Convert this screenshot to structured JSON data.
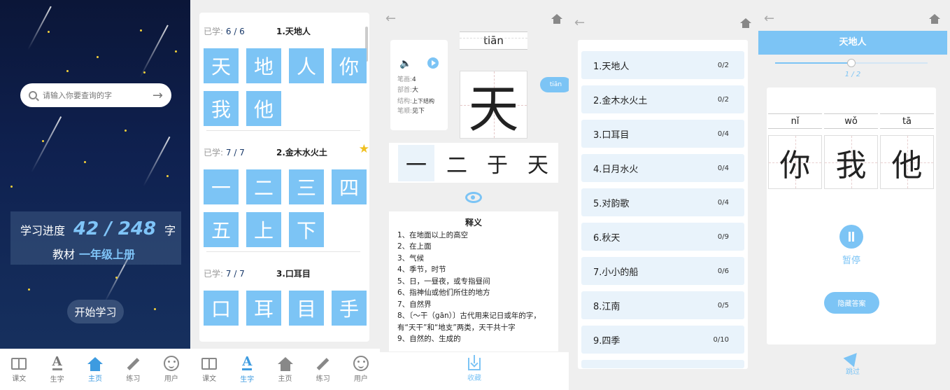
{
  "home": {
    "search_placeholder": "请输入你要查询的字",
    "progress_label": "学习进度",
    "progress_value": "42 / 248",
    "progress_unit": "字",
    "textbook_label": "教材",
    "textbook_value": "一年级上册",
    "start_button": "开始学习"
  },
  "tabs": [
    "课文",
    "生字",
    "主页",
    "练习",
    "用户"
  ],
  "char_list": {
    "lessons": [
      {
        "learned_label": "已学:",
        "learned": "6 / 6",
        "title": "1.天地人",
        "starred": false,
        "chars": [
          "天",
          "地",
          "人",
          "你",
          "我",
          "他"
        ]
      },
      {
        "learned_label": "已学:",
        "learned": "7 / 7",
        "title": "2.金木水火土",
        "starred": true,
        "chars": [
          "一",
          "二",
          "三",
          "四",
          "五",
          "上",
          "下"
        ]
      },
      {
        "learned_label": "已学:",
        "learned": "7 / 7",
        "title": "3.口耳目",
        "starred": false,
        "chars": [
          "口",
          "耳",
          "目",
          "手"
        ]
      }
    ]
  },
  "detail": {
    "pinyin": "tiān",
    "char": "天",
    "pinyin_button": "tiān",
    "info": [
      {
        "label": "笔画:",
        "value": "4"
      },
      {
        "label": "部首:",
        "value": "大"
      },
      {
        "label": "结构:",
        "value": "上下结构"
      },
      {
        "label": "笔顺:",
        "value": "见下"
      }
    ],
    "strokes": [
      "一",
      "二",
      "于",
      "天"
    ],
    "def_title": "释义",
    "definitions": [
      "1、在地面以上的高空",
      "2、在上面",
      "3、气候",
      "4、季节，时节",
      "5、日，一昼夜，或专指昼间",
      "6、指神仙或他们所住的地方",
      "7、自然界",
      "8、〔～干（gān）〕古代用来记日或年的字，有“天干”和“地支”两类，天干共十字",
      "9、自然的、生成的"
    ],
    "collect_label": "收藏"
  },
  "lesson_list": [
    {
      "title": "1.天地人",
      "count": "0/2"
    },
    {
      "title": "2.金木水火土",
      "count": "0/2"
    },
    {
      "title": "3.口耳目",
      "count": "0/4"
    },
    {
      "title": "4.日月水火",
      "count": "0/4"
    },
    {
      "title": "5.对韵歌",
      "count": "0/4"
    },
    {
      "title": "6.秋天",
      "count": "0/9"
    },
    {
      "title": "7.小小的船",
      "count": "0/6"
    },
    {
      "title": "8.江南",
      "count": "0/5"
    },
    {
      "title": "9.四季",
      "count": "0/10"
    }
  ],
  "practice": {
    "title": "天地人",
    "progress_fraction": 0.5,
    "page": "1 / 2",
    "pinyin": [
      "nǐ",
      "wǒ",
      "tā"
    ],
    "chars": [
      "你",
      "我",
      "他"
    ],
    "pause_label": "暂停",
    "hide_button": "隐藏答案",
    "skip_label": "跳过"
  },
  "colors": {
    "accent": "#7cc4f5",
    "night_sky": "#0f2150",
    "star": "#f5d23a"
  }
}
